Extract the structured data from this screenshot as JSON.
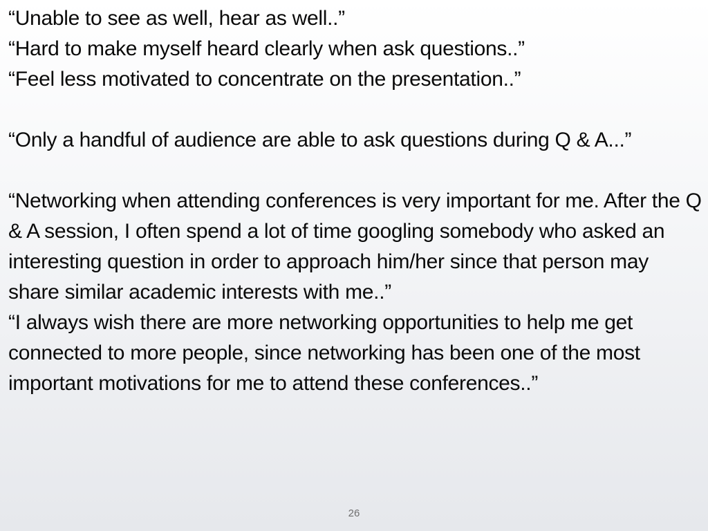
{
  "slide": {
    "quotes": [
      "“Unable to see as well, hear as well..”",
      "“Hard to make myself heard clearly when ask questions..”",
      "“Feel less motivated to concentrate on the presentation..”",
      "“Only a handful of audience are able to ask questions during Q & A...”",
      "“Networking when attending conferences is very important for me. After the Q & A session, I often spend a lot of time googling somebody who asked an interesting question in order to approach him/her since that person may share similar academic interests with me..”",
      "“I always wish there are more networking opportunities to help me get connected to more people, since networking has been one of the most important motivations for me to attend these conferences..”"
    ],
    "page_number": "26"
  }
}
